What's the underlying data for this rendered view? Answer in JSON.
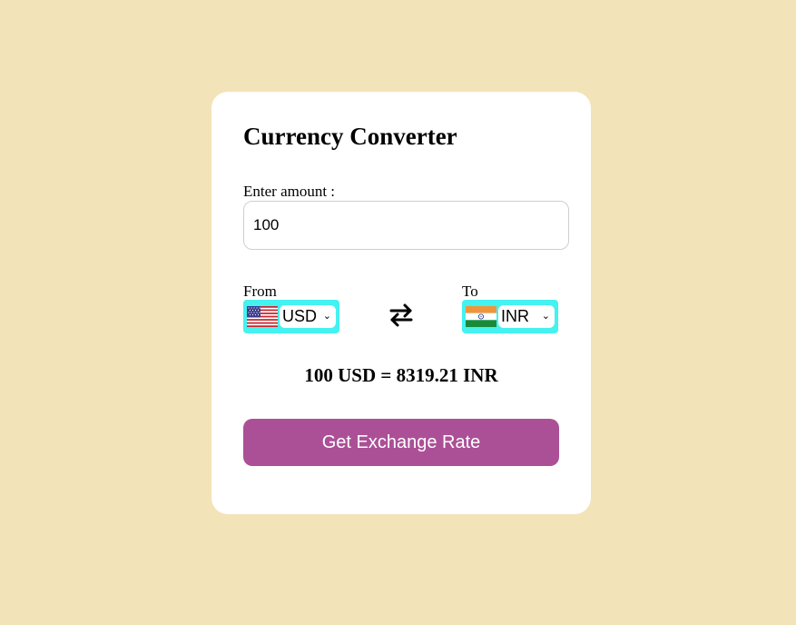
{
  "converter": {
    "title": "Currency Converter",
    "amount_label": "Enter amount :",
    "amount_value": "100",
    "from_label": "From",
    "to_label": "To",
    "from_currency": "USD",
    "to_currency": "INR",
    "from_flag_icon": "us-flag-icon",
    "to_flag_icon": "india-flag-icon",
    "swap_icon": "swap-arrows-icon",
    "result_text": "100 USD = 8319.21 INR",
    "button_label": "Get Exchange Rate"
  },
  "colors": {
    "page_background": "#f3e3b9",
    "card_background": "#ffffff",
    "select_highlight": "#44f2f0",
    "button_background": "#ab5097",
    "button_text": "#ffffff"
  }
}
